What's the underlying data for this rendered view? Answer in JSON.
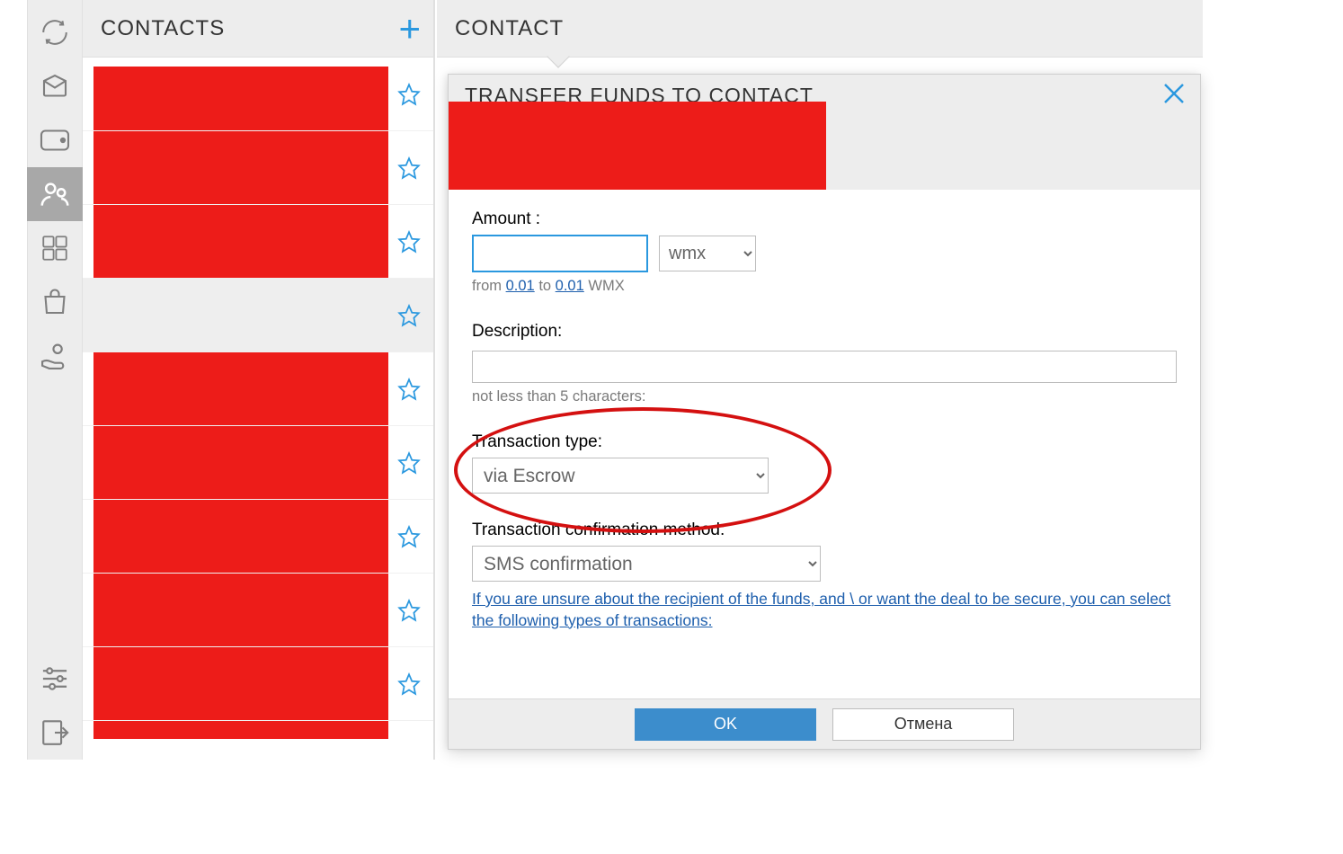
{
  "contacts_panel": {
    "title": "CONTACTS",
    "add_tooltip": "Add contact"
  },
  "contact_panel": {
    "title": "CONTACT"
  },
  "dialog": {
    "title": "TRANSFER FUNDS TO CONTACT",
    "amount_label": "Amount :",
    "currency": "wmx",
    "hint_from": "from",
    "hint_min": "0.01",
    "hint_to": "to",
    "hint_max": "0.01",
    "hint_unit": "WMX",
    "desc_label": "Description:",
    "desc_hint": "not less than 5 characters:",
    "txtype_label": "Transaction type:",
    "txtype_value": "via Escrow",
    "conf_label": "Transaction confirmation method:",
    "conf_value": "SMS confirmation",
    "info_link": "If you are unsure about the recipient of the funds, and \\ or want the deal to be secure, you can select the following types of transactions:",
    "ok": "OK",
    "cancel": "Отмена"
  }
}
